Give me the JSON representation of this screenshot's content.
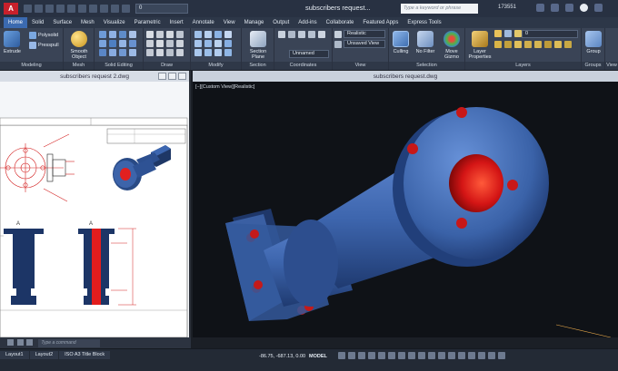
{
  "titlebar": {
    "app_letter": "A",
    "workspace_value": "0",
    "doc_title": "subscribers request...",
    "search_placeholder": "Type a keyword or phrase",
    "user_id": "173551"
  },
  "tabs": [
    "Home",
    "Solid",
    "Surface",
    "Mesh",
    "Visualize",
    "Parametric",
    "Insert",
    "Annotate",
    "View",
    "Manage",
    "Output",
    "Add-ins",
    "Collaborate",
    "Featured Apps",
    "Express Tools"
  ],
  "active_tab": "Home",
  "ribbon": {
    "extrude": "Extrude",
    "polysolid": "Polysolid",
    "presspull": "Presspull",
    "smooth_object_1": "Smooth",
    "smooth_object_2": "Object",
    "section_plane_1": "Section",
    "section_plane_2": "Plane",
    "visual_style": "Realistic",
    "view_state": "Unsaved View",
    "ucs_name": "Unnamed",
    "culling": "Culling",
    "no_filter": "No Filter",
    "move_gizmo_1": "Move",
    "move_gizmo_2": "Gizmo",
    "layer_props_1": "Layer",
    "layer_props_2": "Properties",
    "layer_value": "0",
    "group": "Group",
    "view_btn": "View",
    "panel_titles": {
      "modeling": "Modeling",
      "mesh": "Mesh",
      "solid_editing": "Solid Editing",
      "draw": "Draw",
      "modify": "Modify",
      "section": "Section",
      "coordinates": "Coordinates",
      "view": "View",
      "selection": "Selection",
      "layers": "Layers",
      "groups": "Groups"
    }
  },
  "left_window": {
    "title": "subscribers request 2.dwg",
    "section_label_1": "A",
    "section_label_2": "A"
  },
  "right_window": {
    "title": "subscribers request.dwg",
    "viewport_label": "[−][Custom View][Realistic]"
  },
  "cmdline": {
    "placeholder": "Type a command"
  },
  "status": {
    "layout_tabs": [
      "Layout1",
      "Layout2",
      "ISO A3 Title Block"
    ],
    "coords": "-86.75, -687.13, 0.00",
    "model": "MODEL"
  },
  "colors": {
    "accent": "#3b6ab0",
    "part_blue": "#3c5f9c",
    "part_red": "#e01e1e"
  }
}
